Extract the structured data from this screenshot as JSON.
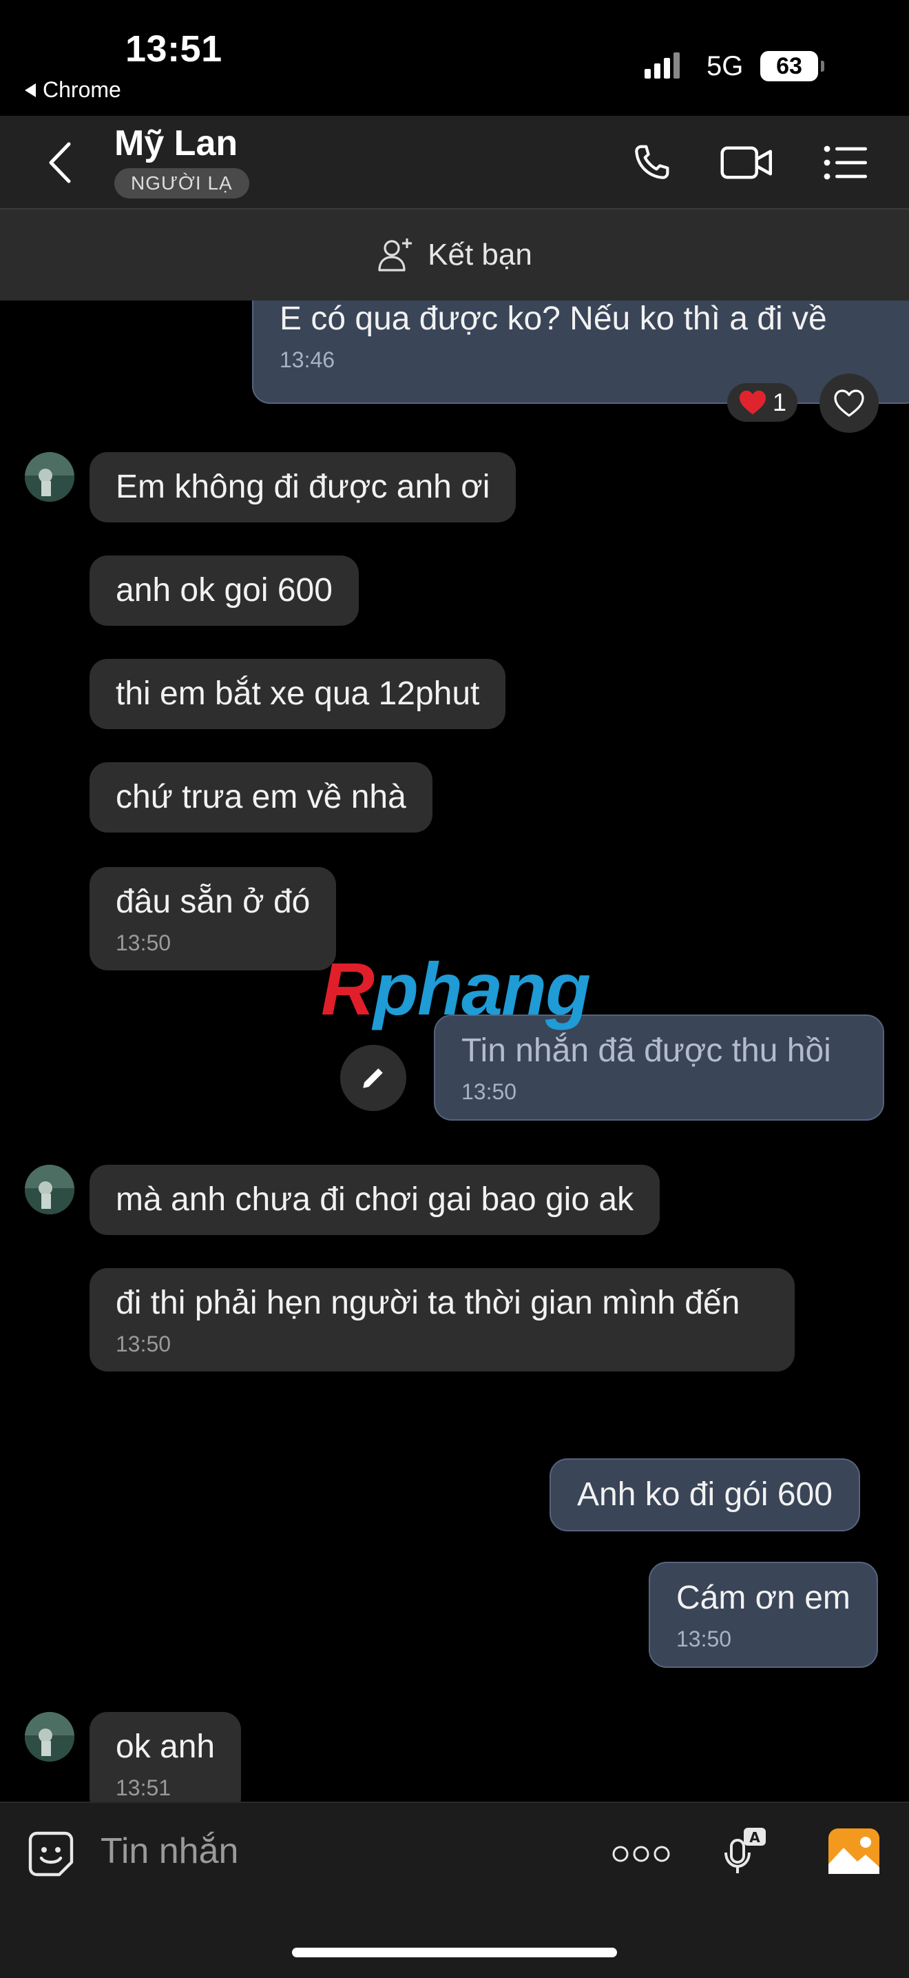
{
  "status_bar": {
    "time": "13:51",
    "back_app": "Chrome",
    "network": "5G",
    "battery": "63"
  },
  "header": {
    "contact_name": "Mỹ Lan",
    "badge": "NGƯỜI LẠ",
    "icons": [
      "back-icon",
      "phone-icon",
      "video-call-icon",
      "menu-list-icon"
    ]
  },
  "friend_bar": {
    "label": "Kết bạn",
    "icon": "add-friend-icon"
  },
  "watermark": {
    "r": "R",
    "rest": "phang"
  },
  "messages": [
    {
      "side": "out",
      "text": "E có qua được ko? Nếu ko thì a đi về",
      "time": "13:46",
      "reaction_count": "1"
    },
    {
      "side": "in",
      "text": "Em không đi được anh ơi"
    },
    {
      "side": "in",
      "text": "anh  ok goi 600"
    },
    {
      "side": "in",
      "text": "thi em bắt xe qua 12phut"
    },
    {
      "side": "in",
      "text": "chứ trưa em về  nhà"
    },
    {
      "side": "in",
      "text": "đâu sẵn ở đó",
      "time": "13:50"
    },
    {
      "side": "out",
      "text": "Tin nhắn đã được thu hồi",
      "time": "13:50",
      "recalled": true
    },
    {
      "side": "in",
      "text": "mà anh chưa đi chơi gai bao gio ak"
    },
    {
      "side": "in",
      "text": "đi thi phải hẹn người ta thời gian  mình đến",
      "time": "13:50"
    },
    {
      "side": "out",
      "text": "Anh ko đi gói 600"
    },
    {
      "side": "out",
      "text": "Cám ơn em",
      "time": "13:50"
    },
    {
      "side": "in",
      "text": "ok anh",
      "time": "13:51"
    }
  ],
  "input": {
    "placeholder": "Tin nhắn",
    "icons": [
      "emoji-sticker-icon",
      "more-dots-icon",
      "voice-to-text-icon",
      "image-gallery-icon"
    ]
  },
  "colors": {
    "background": "#000000",
    "incoming_bubble": "#2e2e2e",
    "outgoing_bubble": "#3a4558",
    "header": "#222222",
    "accent_gallery": "#f39a1e",
    "heart": "#e0242e"
  }
}
